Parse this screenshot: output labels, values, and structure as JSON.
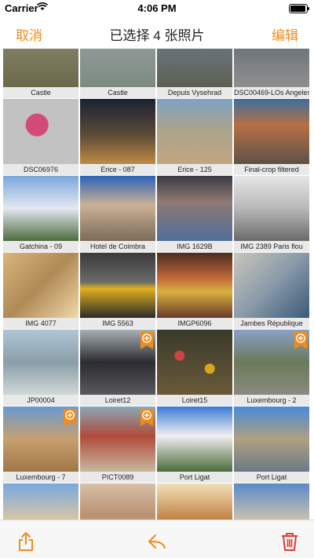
{
  "status": {
    "carrier": "Carrier",
    "time": "4:06 PM"
  },
  "nav": {
    "cancel": "取消",
    "title": "已选择 4 张照片",
    "edit": "编辑"
  },
  "photos": [
    {
      "caption": "Castle",
      "selected": false
    },
    {
      "caption": "Castle",
      "selected": false
    },
    {
      "caption": "Depuis Vysehrad",
      "selected": false
    },
    {
      "caption": "DSC00469-LOs Angeles",
      "selected": false
    },
    {
      "caption": "DSC06976",
      "selected": false
    },
    {
      "caption": "Erice - 087",
      "selected": false
    },
    {
      "caption": "Erice - 125",
      "selected": false
    },
    {
      "caption": "Final-crop filtered",
      "selected": false
    },
    {
      "caption": "Gatchina - 09",
      "selected": false
    },
    {
      "caption": "Hotel de Coimbra",
      "selected": false
    },
    {
      "caption": "IMG 1629B",
      "selected": false
    },
    {
      "caption": "IMG 2389 Paris flou",
      "selected": false
    },
    {
      "caption": "IMG 4077",
      "selected": false
    },
    {
      "caption": "IMG 5563",
      "selected": false
    },
    {
      "caption": "IMGP6096",
      "selected": false
    },
    {
      "caption": "Jambes République",
      "selected": false
    },
    {
      "caption": "JP00004",
      "selected": false
    },
    {
      "caption": "Loiret12",
      "selected": true
    },
    {
      "caption": "Loiret15",
      "selected": false
    },
    {
      "caption": "Luxembourg - 2",
      "selected": true
    },
    {
      "caption": "Luxembourg - 7",
      "selected": true
    },
    {
      "caption": "PICT0089",
      "selected": true
    },
    {
      "caption": "Port Ligat",
      "selected": false
    },
    {
      "caption": "Port Ligat",
      "selected": false
    },
    {
      "caption": "",
      "selected": false
    },
    {
      "caption": "",
      "selected": false
    },
    {
      "caption": "",
      "selected": false
    },
    {
      "caption": "",
      "selected": false
    }
  ],
  "colors": {
    "accent": "#f08c1c",
    "caption_bg": "#e9e9e9",
    "toolbar_delete": "#e53a2e"
  },
  "icons": {
    "share": "share-icon",
    "reply": "reply-icon",
    "delete": "trash-icon"
  }
}
